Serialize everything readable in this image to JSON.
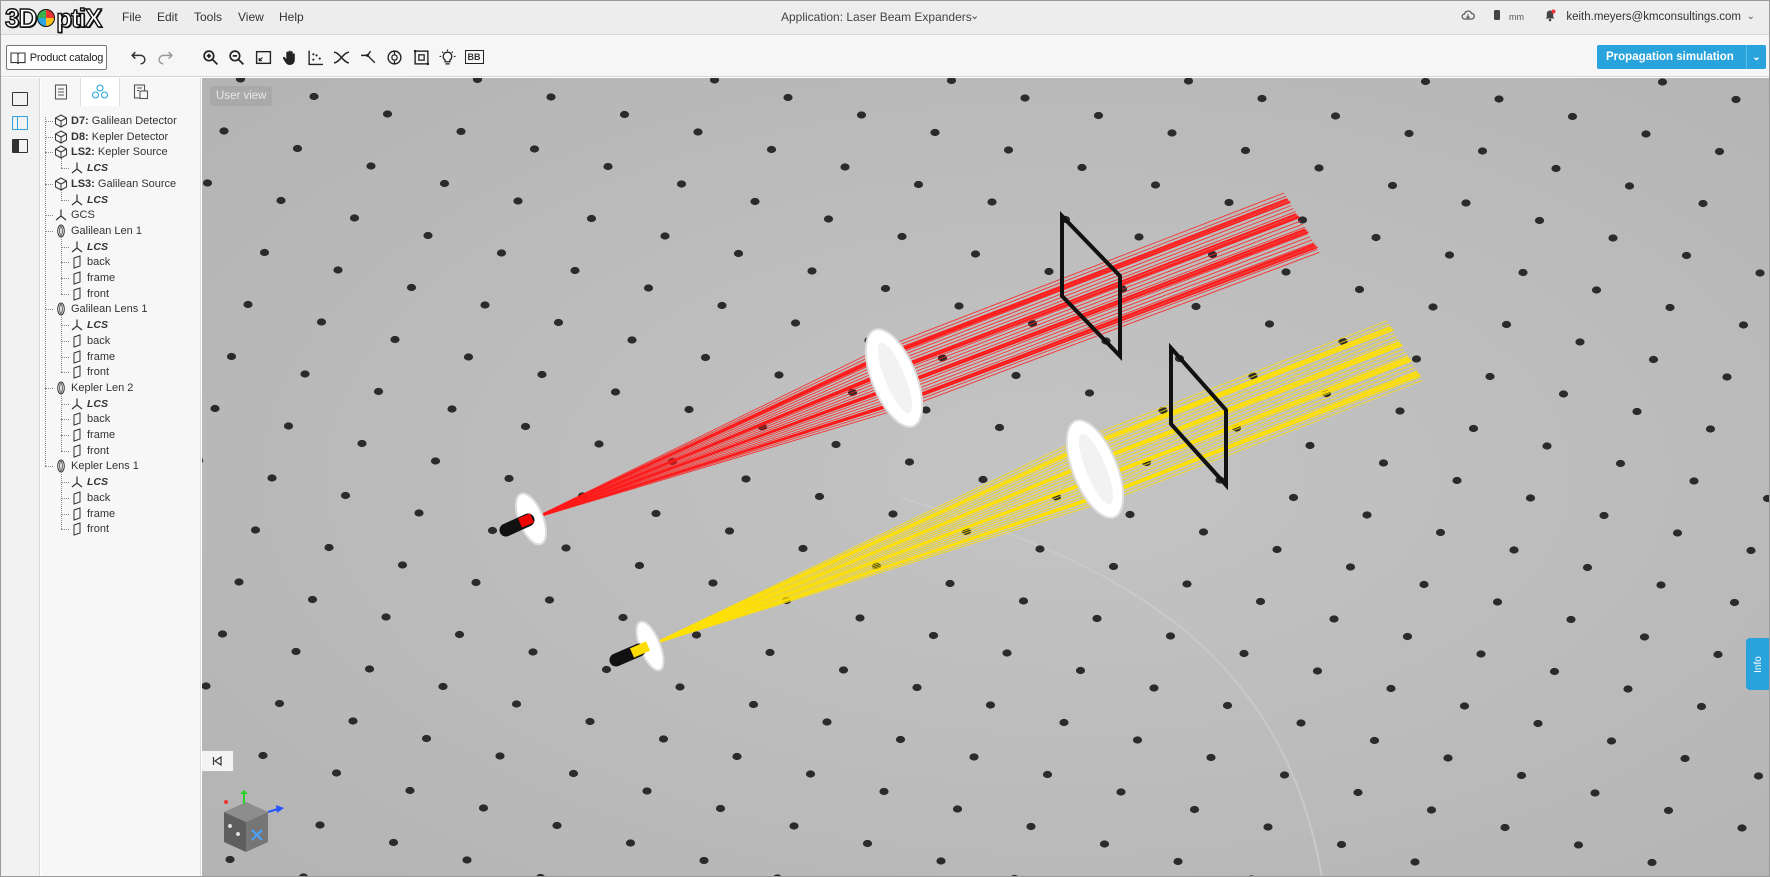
{
  "app": {
    "logo_text": "3DOptiX",
    "title": "Application: Laser Beam Expanders",
    "user_email": "keith.meyers@kmconsultings.com",
    "units": "mm"
  },
  "menu": [
    {
      "label": "File"
    },
    {
      "label": "Edit"
    },
    {
      "label": "Tools"
    },
    {
      "label": "View"
    },
    {
      "label": "Help"
    }
  ],
  "toolbar": {
    "product_catalog": "Product catalog",
    "propagation_simulation": "Propagation simulation",
    "bb_label": "BB"
  },
  "viewport": {
    "view_label": "User view",
    "info_tab": "Info"
  },
  "tree": {
    "items": [
      {
        "bold": "D7:",
        "text": " Galilean Detector",
        "icon": "cube-icon",
        "level": 0
      },
      {
        "bold": "D8:",
        "text": " Kepler Detector",
        "icon": "cube-icon",
        "level": 0
      },
      {
        "bold": "LS2:",
        "text": " Kepler Source",
        "icon": "cube-icon",
        "level": 0
      },
      {
        "italic": "LCS",
        "icon": "axes-icon",
        "level": 1
      },
      {
        "bold": "LS3:",
        "text": " Galilean Source",
        "icon": "cube-icon",
        "level": 0
      },
      {
        "italic": "LCS",
        "icon": "axes-icon",
        "level": 1
      },
      {
        "text": "GCS",
        "icon": "axes-icon",
        "level": 0
      },
      {
        "text": "Galilean Len 1",
        "icon": "lens-icon",
        "level": 0
      },
      {
        "italic": "LCS",
        "icon": "axes-icon",
        "level": 1
      },
      {
        "text": "back",
        "icon": "surface-icon",
        "level": 1
      },
      {
        "text": "frame",
        "icon": "surface-icon",
        "level": 1
      },
      {
        "text": "front",
        "icon": "surface-icon",
        "level": 1
      },
      {
        "text": "Galilean Lens 1",
        "icon": "lens-icon",
        "level": 0
      },
      {
        "italic": "LCS",
        "icon": "axes-icon",
        "level": 1
      },
      {
        "text": "back",
        "icon": "surface-icon",
        "level": 1
      },
      {
        "text": "frame",
        "icon": "surface-icon",
        "level": 1
      },
      {
        "text": "front",
        "icon": "surface-icon",
        "level": 1
      },
      {
        "text": "Kepler Len 2",
        "icon": "lens-icon",
        "level": 0
      },
      {
        "italic": "LCS",
        "icon": "axes-icon",
        "level": 1
      },
      {
        "text": "back",
        "icon": "surface-icon",
        "level": 1
      },
      {
        "text": "frame",
        "icon": "surface-icon",
        "level": 1
      },
      {
        "text": "front",
        "icon": "surface-icon",
        "level": 1
      },
      {
        "text": "Kepler Lens 1",
        "icon": "lens-icon",
        "level": 0
      },
      {
        "italic": "LCS",
        "icon": "axes-icon",
        "level": 1
      },
      {
        "text": "back",
        "icon": "surface-icon",
        "level": 1
      },
      {
        "text": "frame",
        "icon": "surface-icon",
        "level": 1
      },
      {
        "text": "front",
        "icon": "surface-icon",
        "level": 1
      }
    ]
  },
  "colors": {
    "accent": "#29a3dc",
    "beam_red": "#ff1a1a",
    "beam_yellow": "#ffe000",
    "table": "#bdbdbd",
    "holes": "#2b2b2b"
  }
}
